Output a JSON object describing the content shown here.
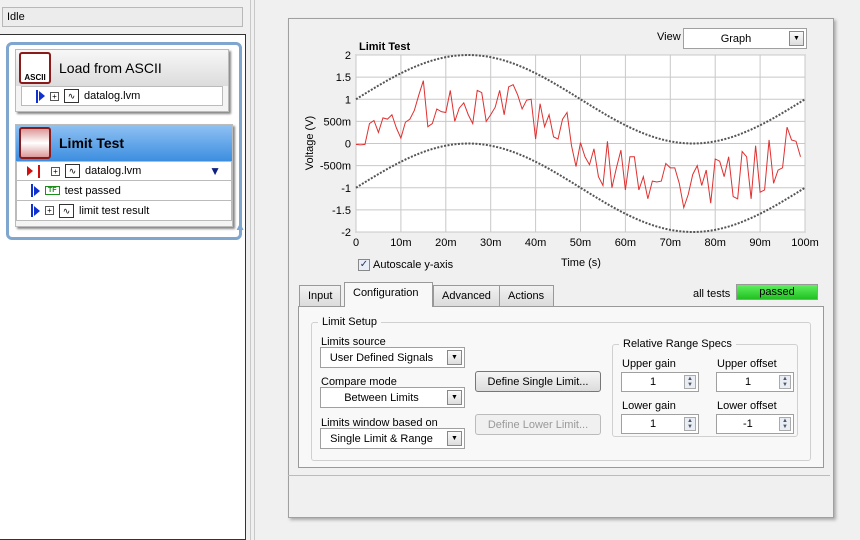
{
  "status": "Idle",
  "steps": [
    {
      "title": "Load from ASCII",
      "icon": "ascii-load-icon",
      "icon_text": "ASCII",
      "rows": [
        {
          "label": "datalog.lvm",
          "type": "waveform",
          "direction": "input"
        }
      ]
    },
    {
      "title": "Limit Test",
      "icon": "limit-test-icon",
      "selected": true,
      "rows": [
        {
          "label": "datalog.lvm",
          "type": "waveform",
          "direction": "input-required"
        },
        {
          "label": "test passed",
          "type": "boolean",
          "type_badge": "TF"
        },
        {
          "label": "limit test result",
          "type": "waveform"
        }
      ]
    }
  ],
  "view": {
    "label": "View",
    "value": "Graph"
  },
  "graph": {
    "title": "Limit Test",
    "autoscale_label": "Autoscale y-axis",
    "autoscale_checked": true
  },
  "chart_data": {
    "type": "line",
    "title": "Limit Test",
    "xlabel": "Time (s)",
    "ylabel": "Voltage (V)",
    "xlim": [
      0,
      0.1
    ],
    "ylim": [
      -2,
      2
    ],
    "grid": true,
    "x_ticks": [
      "0",
      "10m",
      "20m",
      "30m",
      "40m",
      "50m",
      "60m",
      "70m",
      "80m",
      "90m",
      "100m"
    ],
    "y_ticks": [
      "2",
      "1.5",
      "1",
      "500m",
      "0",
      "-500m",
      "-1",
      "-1.5",
      "-2"
    ],
    "signal": {
      "color": "#e03030",
      "dt": 0.001,
      "values": [
        -0.02,
        -0.03,
        -0.02,
        0.45,
        0.52,
        0.25,
        0.58,
        0.55,
        0.65,
        0.35,
        0.12,
        0.48,
        0.55,
        0.75,
        1.1,
        1.42,
        0.38,
        0.45,
        0.78,
        0.72,
        0.7,
        1.2,
        0.5,
        0.8,
        0.92,
        0.65,
        0.45,
        1.2,
        1.15,
        0.5,
        0.65,
        0.82,
        1.2,
        0.65,
        1.28,
        1.33,
        1.1,
        0.78,
        0.98,
        1.0,
        0.1,
        0.9,
        0.38,
        0.65,
        0.15,
        0.1,
        0.55,
        0.7,
        -0.05,
        -0.52,
        0.02,
        -0.3,
        -0.48,
        -0.12,
        -0.75,
        -0.95,
        0.05,
        -1.0,
        -0.55,
        -0.15,
        -1.05,
        -0.3,
        -0.3,
        -1.05,
        -0.75,
        -1.25,
        -0.85,
        -0.87,
        -0.85,
        -0.45,
        -0.55,
        -0.55,
        -0.9,
        -1.45,
        -1.15,
        -0.7,
        -0.5,
        -0.95,
        -0.6,
        -1.35,
        -0.35,
        -0.4,
        -0.75,
        -0.3,
        -1.2,
        -1.25,
        -0.18,
        -0.3,
        -1.25,
        -0.05,
        -1.1,
        -1.05,
        0.08,
        -0.9,
        -0.6,
        -0.55,
        0.37,
        0.08,
        0.05,
        -0.3
      ]
    },
    "upper_limit": {
      "color": "#555555",
      "style": "dotted",
      "formula": "1 + sin(2*pi*10*t)"
    },
    "lower_limit": {
      "color": "#555555",
      "style": "dotted",
      "formula": "-1 + sin(2*pi*10*t)"
    }
  },
  "tabs": [
    "Input",
    "Configuration",
    "Advanced",
    "Actions"
  ],
  "active_tab": "Configuration",
  "all_tests": {
    "label": "all tests",
    "value": "passed",
    "color": "#3ad83a"
  },
  "config": {
    "group": "Limit Setup",
    "limits_source": {
      "label": "Limits source",
      "value": "User Defined Signals"
    },
    "compare_mode": {
      "label": "Compare mode",
      "value": "Between Limits"
    },
    "window": {
      "label": "Limits window based on",
      "value": "Single Limit & Range"
    },
    "define_single": "Define Single Limit...",
    "define_lower": "Define Lower Limit...",
    "range": {
      "group": "Relative Range Specs",
      "upper_gain": {
        "label": "Upper gain",
        "value": "1"
      },
      "upper_offset": {
        "label": "Upper offset",
        "value": "1"
      },
      "lower_gain": {
        "label": "Lower gain",
        "value": "1"
      },
      "lower_offset": {
        "label": "Lower offset",
        "value": "-1"
      }
    }
  }
}
